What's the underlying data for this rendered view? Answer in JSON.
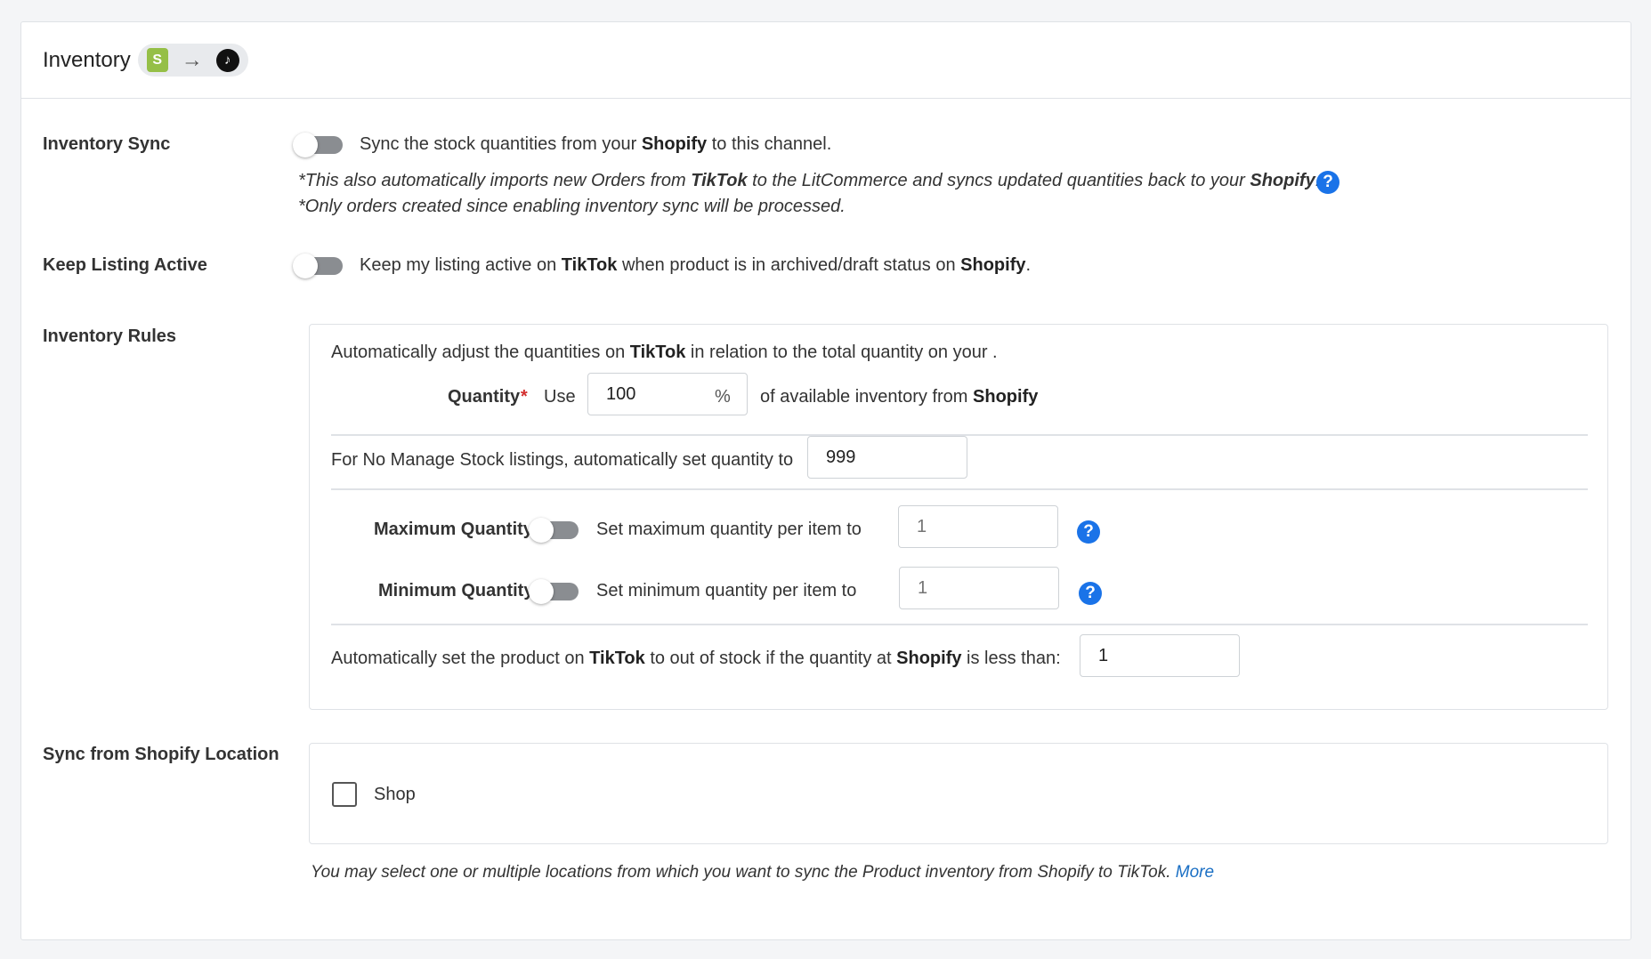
{
  "header": {
    "title": "Inventory",
    "shopify_glyph": "S",
    "arrow_glyph": "→",
    "tiktok_glyph": "♪"
  },
  "inventory_sync": {
    "label": "Inventory Sync",
    "desc_pre": "Sync the stock quantities from your ",
    "desc_bold": "Shopify",
    "desc_post": " to this channel.",
    "note1_pre": "*This also automatically imports new Orders from ",
    "note1_b1": "TikTok",
    "note1_mid": " to the LitCommerce and syncs updated quantities back to your ",
    "note1_b2": "Shopify",
    "note1_post": ".",
    "note2": "*Only orders created since enabling inventory sync will be processed.",
    "help_glyph": "?"
  },
  "keep_listing": {
    "label": "Keep Listing Active",
    "pre": "Keep my listing active on ",
    "b1": "TikTok",
    "mid": " when product is in archived/draft status on ",
    "b2": "Shopify",
    "post": "."
  },
  "rules": {
    "label": "Inventory Rules",
    "intro_pre": "Automatically adjust the quantities on ",
    "intro_bold": "TikTok",
    "intro_post": " in relation to the total quantity on your .",
    "quantity_label": "Quantity",
    "required_mark": "*",
    "use_label": "Use",
    "quantity_value": "100",
    "percent": "%",
    "avail_pre": "of available inventory from ",
    "avail_bold": "Shopify",
    "no_manage_label": "For No Manage Stock listings, automatically set quantity to",
    "no_manage_value": "999",
    "max_label": "Maximum Quantity",
    "max_desc": "Set maximum quantity per item to",
    "max_value": "1",
    "min_label": "Minimum Quantity",
    "min_desc": "Set minimum quantity per item to",
    "min_value": "1",
    "oos_pre": "Automatically set the product on ",
    "oos_b1": "TikTok",
    "oos_mid": " to out of stock if the quantity at ",
    "oos_b2": "Shopify",
    "oos_post": " is less than:",
    "oos_value": "1",
    "help_glyph": "?"
  },
  "locations": {
    "label": "Sync from Shopify Location",
    "items": [
      {
        "label": "Shop",
        "checked": false
      }
    ],
    "hint": "You may select one or multiple locations from which you want to sync the Product inventory from Shopify to TikTok. ",
    "more_link": "More"
  },
  "colors": {
    "accent": "#1a73e8",
    "shopify": "#95bf47",
    "toggle_off": "#8a8d91"
  }
}
